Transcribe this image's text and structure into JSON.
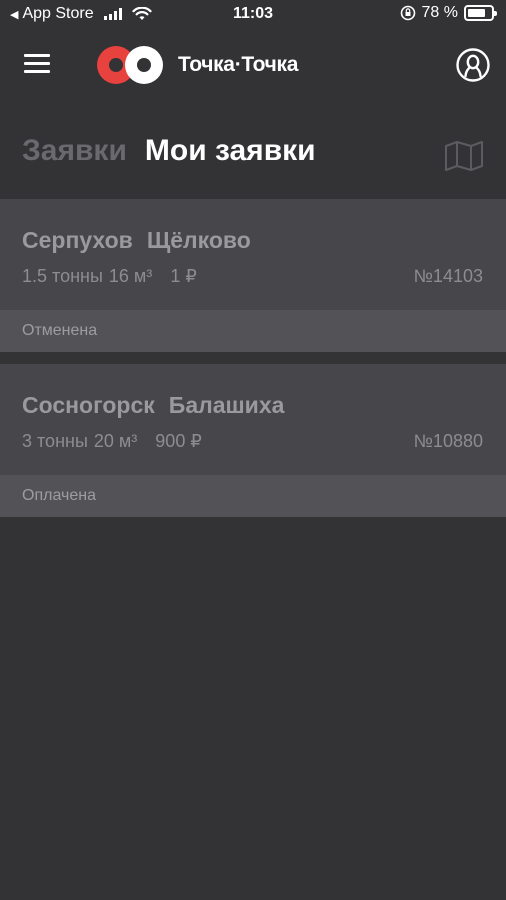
{
  "status_bar": {
    "back_label": "App Store",
    "time": "11:03",
    "battery": "78 %",
    "battery_level": 0.78
  },
  "header": {
    "logo_text": "Точка·Точка"
  },
  "tabs": [
    {
      "label": "Заявки",
      "active": false
    },
    {
      "label": "Мои заявки",
      "active": true
    }
  ],
  "orders": [
    {
      "from": "Серпухов",
      "to": "Щёлково",
      "weight": "1.5 тонны",
      "volume": "16 м³",
      "price": "1 ₽",
      "number": "№14103",
      "status": "Отменена"
    },
    {
      "from": "Сосногорск",
      "to": "Балашиха",
      "weight": "3 тонны",
      "volume": "20 м³",
      "price": "900 ₽",
      "number": "№10880",
      "status": "Оплачена"
    }
  ],
  "colors": {
    "background": "#333336",
    "card": "#47474b",
    "status_strip": "#535357",
    "brand_red": "#e8423f"
  }
}
